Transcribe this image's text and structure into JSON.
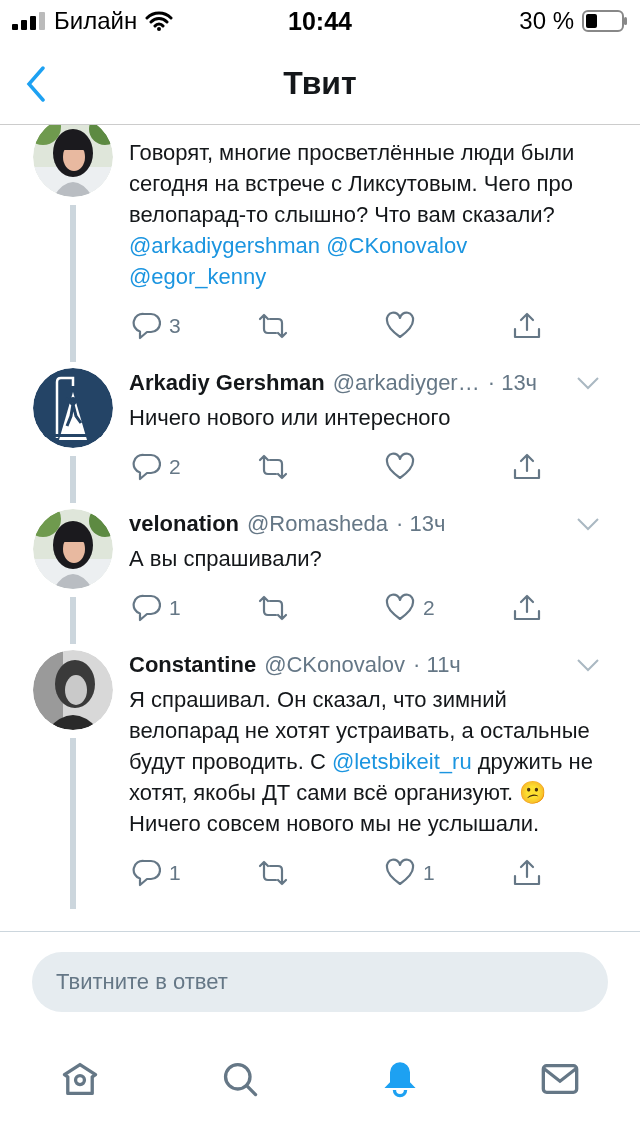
{
  "status_bar": {
    "carrier": "Билайн",
    "time": "10:44",
    "battery": "30 %"
  },
  "nav": {
    "title": "Твит"
  },
  "tweets": [
    {
      "segments": [
        {
          "kind": "text",
          "text": "Говорят, многие просветлённые люди были сегодня на встрече с Ликсутовым. Чего про велопарад-то слышно? Что вам сказали?"
        },
        {
          "kind": "mention",
          "text": "@arkadiygershman"
        },
        {
          "kind": "mention",
          "text": "@CKonovalov"
        },
        {
          "kind": "mention",
          "text": "@egor_kenny"
        }
      ],
      "replies": "3"
    },
    {
      "avatar": {
        "kind": "logo"
      },
      "name": "Arkadiy Gershman",
      "handle": "@arkadiyger…",
      "time": "· 13ч",
      "segments": [
        {
          "kind": "text",
          "text": "Ничего нового или интересного"
        }
      ],
      "replies": "2"
    },
    {
      "name": "velonation",
      "handle": "@Romasheda",
      "time": "· 13ч",
      "segments": [
        {
          "kind": "text",
          "text": "А вы спрашивали?"
        }
      ],
      "replies": "1",
      "likes": "2"
    },
    {
      "avatar": {
        "kind": "photo2"
      },
      "name": "Constantine",
      "handle": "@CKonovalov",
      "time": "· 11ч",
      "segments": [
        {
          "kind": "text",
          "text": "Я спрашивал. Он сказал, что зимний велопарад не хотят устраивать, а остальные будут проводить. С"
        },
        {
          "kind": "mention",
          "text": "@letsbikeit_ru"
        },
        {
          "kind": "text",
          "text": "дружить не хотят, якобы ДТ сами всё организуют. 😕 Ничего совсем нового мы не услышали."
        }
      ],
      "replies": "1",
      "likes": "1"
    }
  ],
  "composer": {
    "placeholder": "Твитните в ответ"
  },
  "tabs": [
    {
      "kind": "home",
      "selected": false
    },
    {
      "kind": "search",
      "selected": false
    },
    {
      "kind": "notifications",
      "selected": true
    },
    {
      "kind": "messages",
      "selected": false
    }
  ]
}
